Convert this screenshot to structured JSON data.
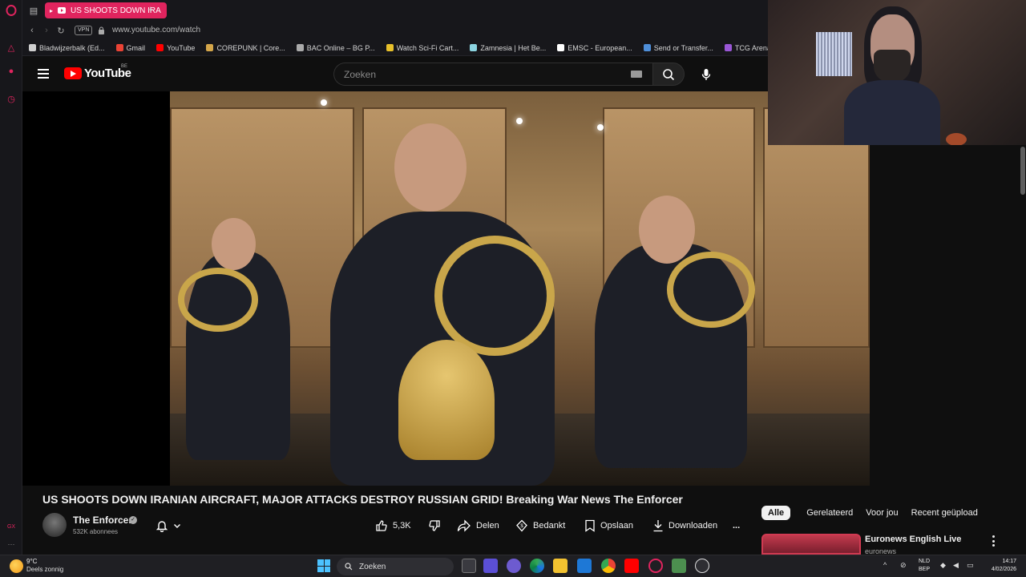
{
  "browser": {
    "active_tab_title": "US SHOOTS DOWN IRA",
    "url": "www.youtube.com/watch",
    "vpn_label": "VPN",
    "bookmarks": [
      {
        "label": "Bladwijzerbalk (Ed...",
        "icon": "folder-icon",
        "color": "#cfcfcf"
      },
      {
        "label": "Gmail",
        "icon": "gmail-icon",
        "color": "#ea4335"
      },
      {
        "label": "YouTube",
        "icon": "youtube-icon",
        "color": "#ff0000"
      },
      {
        "label": "COREPUNK | Core...",
        "icon": "corepunk-icon",
        "color": "#d4a64a"
      },
      {
        "label": "BAC Online – BG P...",
        "icon": "bac-icon",
        "color": "#aaaaaa"
      },
      {
        "label": "Watch Sci-Fi Cart...",
        "icon": "scifi-icon",
        "color": "#e7c02a"
      },
      {
        "label": "Zamnesia | Het Be...",
        "icon": "zamnesia-icon",
        "color": "#8bd3e0"
      },
      {
        "label": "EMSC - European...",
        "icon": "emsc-icon",
        "color": "#ffffff"
      },
      {
        "label": "Send or Transfer...",
        "icon": "transfer-icon",
        "color": "#4f8fd9"
      },
      {
        "label": "TCG Arena",
        "icon": "tcg-icon",
        "color": "#9a57d6"
      }
    ]
  },
  "youtube": {
    "logo_text": "YouTube",
    "region": "BE",
    "search_placeholder": "Zoeken"
  },
  "video": {
    "title": "US SHOOTS DOWN IRANIAN AIRCRAFT, MAJOR ATTACKS DESTROY RUSSIAN GRID! Breaking War News The Enforcer",
    "channel": "The Enforcer",
    "subscribers": "532K abonnees",
    "likes": "5,3K",
    "actions": {
      "share": "Delen",
      "thanks": "Bedankt",
      "save": "Opslaan",
      "download": "Downloaden",
      "more": "..."
    }
  },
  "chips": [
    "Alle",
    "Gerelateerd",
    "Voor jou",
    "Recent geüpload"
  ],
  "related": {
    "title": "Euronews English Live",
    "channel": "euronews"
  },
  "taskbar": {
    "temperature": "9°C",
    "weather": "Deels zonnig",
    "search_label": "Zoeken",
    "lang_top": "NLD",
    "lang_bottom": "BEP",
    "time": "14:17",
    "date": "4/02/2026"
  },
  "colors": {
    "accent_opera": "#e0245e",
    "youtube_red": "#ff0000",
    "background": "#0f0f0f"
  }
}
